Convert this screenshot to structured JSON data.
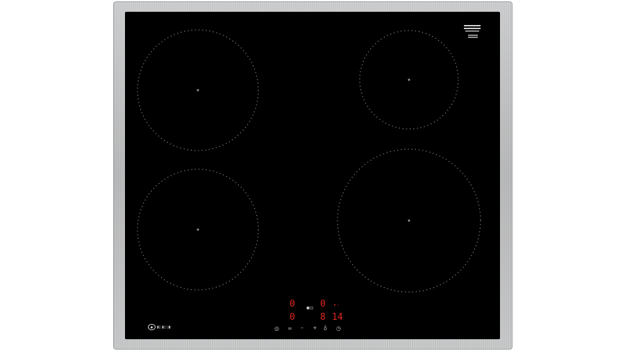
{
  "colors": {
    "frame": "#c3c4c5",
    "glass": "#000000",
    "zone_marking": "#8a8a8a",
    "display_red": "#e0281e"
  },
  "display": {
    "top_left_level": "0",
    "top_right_level": "0",
    "bottom_left_level": "0",
    "bottom_right_level": "8",
    "timer_value": "14"
  },
  "zones": [
    "rear-left",
    "front-left",
    "rear-right",
    "front-right"
  ]
}
